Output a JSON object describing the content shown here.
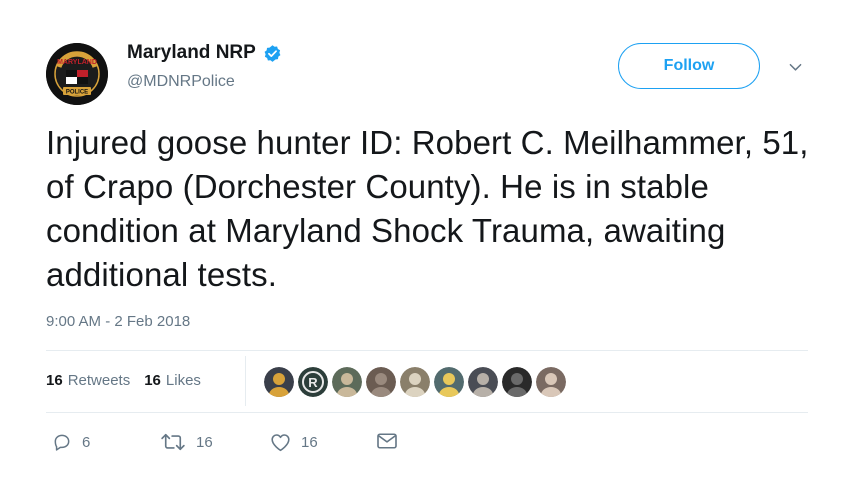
{
  "account": {
    "display_name": "Maryland NRP",
    "handle": "@MDNRPolice",
    "verified": true,
    "avatar_text_top": "MARYLAND",
    "avatar_text_bottom": "POLICE"
  },
  "follow": {
    "label": "Follow"
  },
  "tweet": {
    "text": "Injured goose hunter ID: Robert C. Meilhammer, 51, of Crapo (Dorchester County). He is in stable condition at Maryland Shock Trauma, awaiting additional tests.",
    "timestamp": "9:00 AM - 2 Feb 2018"
  },
  "stats": {
    "retweets_count": "16",
    "retweets_label": "Retweets",
    "likes_count": "16",
    "likes_label": "Likes"
  },
  "likers": [
    {
      "color": "#3a3f4a",
      "accent": "#d8a23a"
    },
    {
      "color": "#2c3e3a",
      "accent": "#e8e8e8",
      "letter": "R"
    },
    {
      "color": "#5d6b5a",
      "accent": "#c9b89a"
    },
    {
      "color": "#6b5c52",
      "accent": "#9a8a7e"
    },
    {
      "color": "#8a7f6a",
      "accent": "#dcd3c0"
    },
    {
      "color": "#526b6e",
      "accent": "#e8c85a"
    },
    {
      "color": "#4a4d55",
      "accent": "#b7b0a8"
    },
    {
      "color": "#2a2a2a",
      "accent": "#6a6a6a"
    },
    {
      "color": "#7a6a62",
      "accent": "#d9c7b8"
    }
  ],
  "actions": {
    "reply_count": "6",
    "retweet_count": "16",
    "like_count": "16"
  },
  "colors": {
    "accent": "#1da1f2",
    "text": "#14171a",
    "muted": "#657786",
    "divider": "#e6ecf0"
  }
}
